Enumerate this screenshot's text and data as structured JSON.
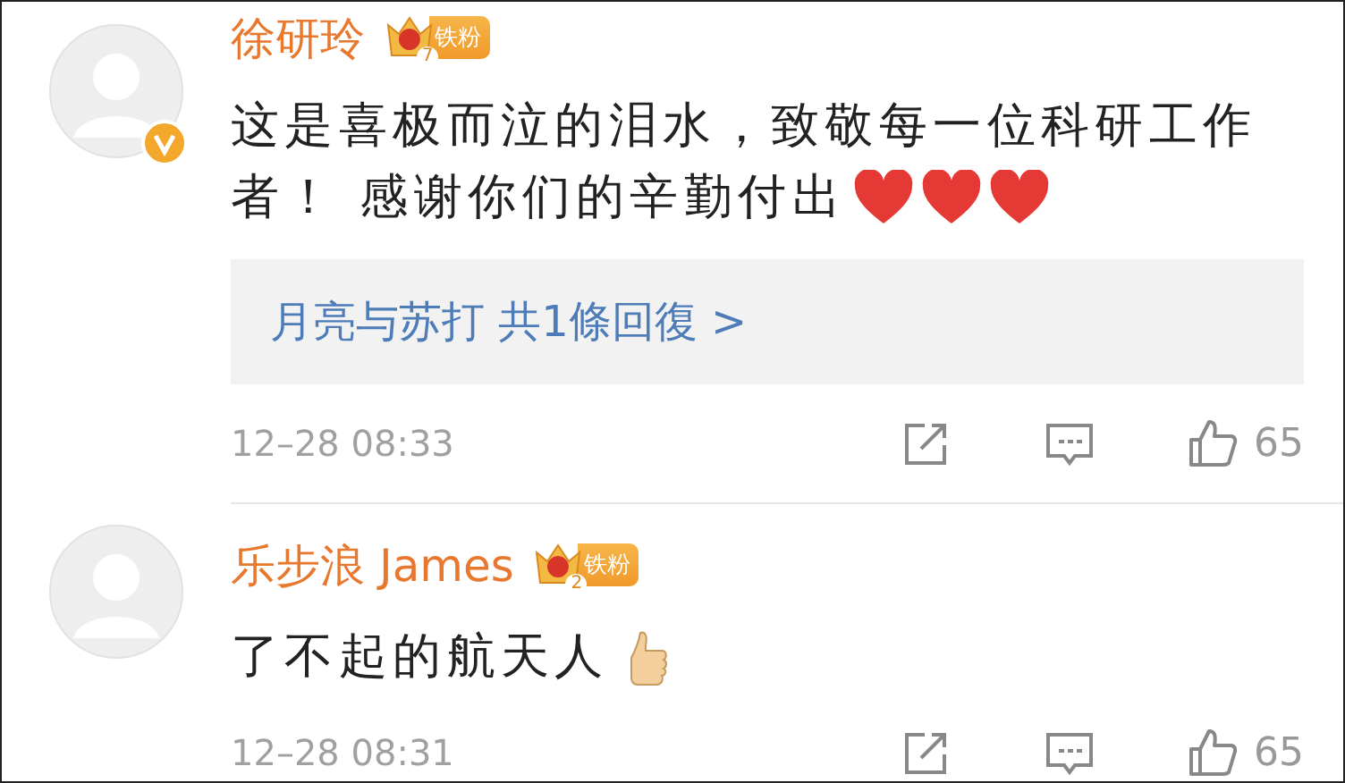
{
  "comments": [
    {
      "author": "徐研玲",
      "verified": true,
      "badge": {
        "level": "7",
        "label": "铁粉"
      },
      "lines": [
        "这是喜极而泣的泪水，致敬每一位科研工作",
        "者！ 感谢你们的辛勤付出"
      ],
      "emojis": [
        {
          "kind": "heart"
        },
        {
          "kind": "heart"
        },
        {
          "kind": "heart"
        }
      ],
      "reply": {
        "user": "月亮与苏打",
        "summary": "共1條回復 >"
      },
      "time": "12–28 08:33",
      "likes": "65"
    },
    {
      "author": "乐步浪 James",
      "badge": {
        "level": "2",
        "label": "铁粉"
      },
      "lines": [
        "了不起的航天人"
      ],
      "emojis": [
        {
          "kind": "thumbs"
        }
      ],
      "time": "12–28 08:31",
      "likes": "65"
    }
  ]
}
